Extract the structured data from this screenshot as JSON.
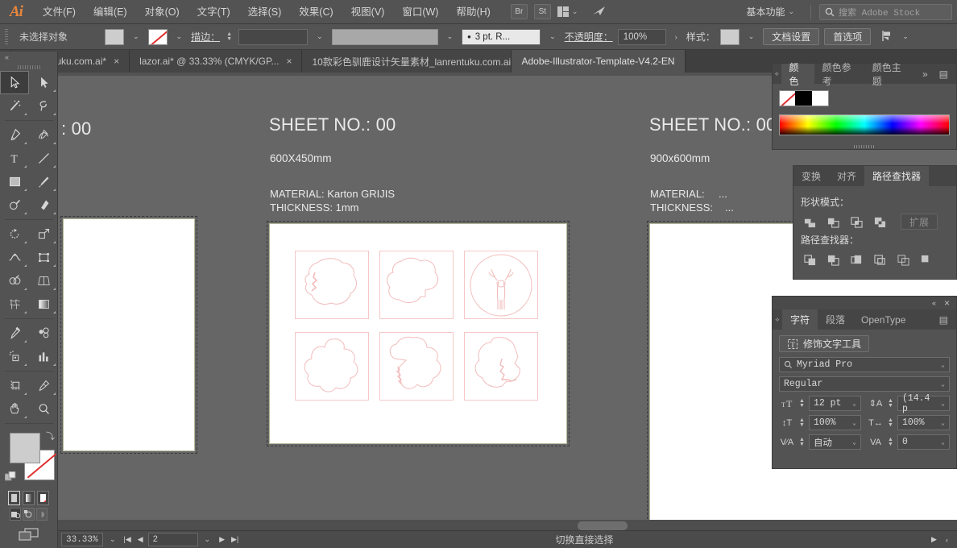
{
  "app": {
    "logo": "Ai",
    "menus": [
      "文件(F)",
      "编辑(E)",
      "对象(O)",
      "文字(T)",
      "选择(S)",
      "效果(C)",
      "视图(V)",
      "窗口(W)",
      "帮助(H)"
    ],
    "bridge_button": "Br",
    "stock_button": "St",
    "workspace": "基本功能",
    "search_placeholder": "搜索 Adobe Stock"
  },
  "control_bar": {
    "selection_status": "未选择对象",
    "stroke_label": "描边：",
    "stroke_weight": "",
    "brush_preset": "3 pt. R...",
    "opacity_label": "不透明度：",
    "opacity_value": "100%",
    "style_label": "样式：",
    "doc_setup": "文档设置",
    "preferences": "首选项"
  },
  "tabs": [
    {
      "title": "_lanrentuku.com.ai*",
      "active": false,
      "closable": true
    },
    {
      "title": "lazor.ai* @ 33.33% (CMYK/GP...",
      "active": false,
      "closable": true
    },
    {
      "title": "10款彩色驯鹿设计矢量素材_lanrentuku.com.ai",
      "active": false,
      "closable": true
    },
    {
      "title": "Adobe-Illustrator-Template-V4.2-EN",
      "active": true,
      "closable": false
    }
  ],
  "toolbar": {
    "collapse": "«",
    "tools": [
      "selection-tool",
      "direct-selection-tool",
      "magic-wand-tool",
      "lasso-tool",
      "pen-tool",
      "curvature-tool",
      "type-tool",
      "line-segment-tool",
      "rectangle-tool",
      "paintbrush-tool",
      "shaper-tool",
      "eraser-tool",
      "rotate-tool",
      "scale-tool",
      "width-tool",
      "free-transform-tool",
      "shape-builder-tool",
      "perspective-grid-tool",
      "mesh-tool",
      "gradient-tool",
      "eyedropper-tool",
      "blend-tool",
      "symbol-sprayer-tool",
      "column-graph-tool",
      "artboard-tool",
      "slice-tool",
      "hand-tool",
      "zoom-tool"
    ],
    "fill_stroke": {
      "fill_color": "#cdcdcd",
      "stroke_color": "none",
      "swap_icon": "swap-fill-stroke-icon",
      "default_icon": "default-fill-stroke-icon"
    },
    "fill_modes": [
      "color-fill",
      "gradient-fill",
      "none-fill"
    ],
    "draw_modes": [
      "draw-normal",
      "draw-behind",
      "draw-inside"
    ],
    "screen_mode": "change-screen-mode"
  },
  "canvas": {
    "artboards": [
      {
        "name": "artboard-left",
        "sheet_no": ": 00",
        "size": "",
        "material": "",
        "thickness": ""
      },
      {
        "name": "artboard-center",
        "sheet_no": "SHEET NO.: 00",
        "size": "600X450mm",
        "material": "MATERIAL: Karton GRIJIS",
        "thickness": "THICKNESS:  1mm"
      },
      {
        "name": "artboard-right",
        "sheet_no": "SHEET NO.: 00",
        "size": "900x600mm",
        "material_label": "MATERIAL:",
        "material_value": "...",
        "thickness_label": "THICKNESS:",
        "thickness_value": "..."
      }
    ],
    "die_cut_outline_color": "#f3bcbc"
  },
  "panels": {
    "color": {
      "tabs": [
        "颜色",
        "颜色参考",
        "颜色主题"
      ],
      "active_tab": "颜色",
      "overflow": "»",
      "swatches": [
        "none",
        "black",
        "white"
      ]
    },
    "pathfinder": {
      "tabs": [
        "变换",
        "对齐",
        "路径查找器"
      ],
      "active_tab": "路径查找器",
      "shape_modes_label": "形状模式：",
      "expand_button": "扩展",
      "pathfinders_label": "路径查找器："
    },
    "character": {
      "tabs": [
        "字符",
        "段落",
        "OpenType"
      ],
      "active_tab": "字符",
      "touch_type_button": "修饰文字工具",
      "font_family": "Myriad Pro",
      "font_style": "Regular",
      "font_size": "12 pt",
      "leading": "(14.4 p",
      "vertical_scale": "100%",
      "horizontal_scale": "100%",
      "kerning": "自动",
      "tracking": "0",
      "collapse_icon": "«",
      "close_icon": "×",
      "menu_icon": "panel-menu-icon"
    }
  },
  "status_bar": {
    "zoom": "33.33%",
    "artboard_number": "2",
    "status_text": "切换直接选择"
  }
}
